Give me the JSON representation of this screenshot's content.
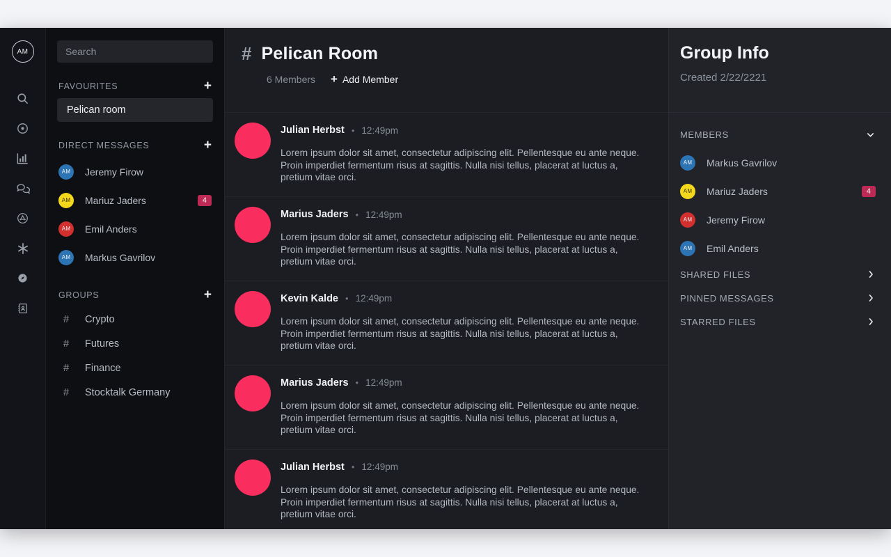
{
  "rail": {
    "avatar_initials": "AM",
    "icons": [
      {
        "name": "search-icon"
      },
      {
        "name": "record-circle-icon"
      },
      {
        "name": "bar-chart-icon"
      },
      {
        "name": "chat-bubbles-icon"
      },
      {
        "name": "app-store-circle-icon"
      },
      {
        "name": "asterisk-icon"
      },
      {
        "name": "compass-icon"
      },
      {
        "name": "address-book-icon"
      }
    ]
  },
  "sidebar": {
    "search": {
      "value": "",
      "placeholder": "Search"
    },
    "favourites": {
      "title": "FAVOURITES",
      "add_label": "+",
      "items": [
        {
          "label": "Pelican room"
        }
      ]
    },
    "direct_messages": {
      "title": "DIRECT MESSAGES",
      "add_label": "+",
      "items": [
        {
          "name": "Jeremy Firow",
          "initials": "AM",
          "color": "#2d74b5",
          "badge": ""
        },
        {
          "name": "Mariuz Jaders",
          "initials": "AM",
          "color": "#f4d81b",
          "badge": "4",
          "initials_color": "#3a3208"
        },
        {
          "name": "Emil Anders",
          "initials": "AM",
          "color": "#d2302f",
          "badge": ""
        },
        {
          "name": "Markus Gavrilov",
          "initials": "AM",
          "color": "#2d74b5",
          "badge": ""
        }
      ]
    },
    "groups": {
      "title": "GROUPS",
      "add_label": "+",
      "items": [
        {
          "label": "Crypto",
          "hash": "#"
        },
        {
          "label": "Futures",
          "hash": "#"
        },
        {
          "label": "Finance",
          "hash": "#"
        },
        {
          "label": "Stocktalk Germany",
          "hash": "#"
        }
      ]
    }
  },
  "chat": {
    "hash": "#",
    "title": "Pelican Room",
    "members_count": "6 Members",
    "add_member_plus": "+",
    "add_member_label": "Add Member",
    "messages": [
      {
        "author": "Julian Herbst",
        "dot": "•",
        "time": "12:49pm",
        "avatar_color": "#f92e5e",
        "text": "Lorem ipsum dolor sit amet, consectetur adipiscing elit. Pellentesque eu ante neque. Proin imperdiet fermentum risus at sagittis. Nulla nisi tellus, placerat at luctus a, pretium vitae orci."
      },
      {
        "author": "Marius Jaders",
        "dot": "•",
        "time": "12:49pm",
        "avatar_color": "#f92e5e",
        "text": "Lorem ipsum dolor sit amet, consectetur adipiscing elit. Pellentesque eu ante neque. Proin imperdiet fermentum risus at sagittis. Nulla nisi tellus, placerat at luctus a, pretium vitae orci."
      },
      {
        "author": "Kevin Kalde",
        "dot": "•",
        "time": "12:49pm",
        "avatar_color": "#f92e5e",
        "text": "Lorem ipsum dolor sit amet, consectetur adipiscing elit. Pellentesque eu ante neque. Proin imperdiet fermentum risus at sagittis. Nulla nisi tellus, placerat at luctus a, pretium vitae orci."
      },
      {
        "author": "Marius Jaders",
        "dot": "•",
        "time": "12:49pm",
        "avatar_color": "#f92e5e",
        "text": "Lorem ipsum dolor sit amet, consectetur adipiscing elit. Pellentesque eu ante neque. Proin imperdiet fermentum risus at sagittis. Nulla nisi tellus, placerat at luctus a, pretium vitae orci."
      },
      {
        "author": "Julian Herbst",
        "dot": "•",
        "time": "12:49pm",
        "avatar_color": "#f92e5e",
        "text": "Lorem ipsum dolor sit amet, consectetur adipiscing elit. Pellentesque eu ante neque. Proin imperdiet fermentum risus at sagittis. Nulla nisi tellus, placerat at luctus a, pretium vitae orci."
      }
    ]
  },
  "group_info": {
    "title": "Group Info",
    "created": "Created 2/22/2221",
    "members_label": "MEMBERS",
    "members": [
      {
        "name": "Markus Gavrilov",
        "initials": "AM",
        "color": "#2d74b5",
        "badge": ""
      },
      {
        "name": "Mariuz Jaders",
        "initials": "AM",
        "color": "#f4d81b",
        "badge": "4",
        "initials_color": "#3a3208"
      },
      {
        "name": "Jeremy Firow",
        "initials": "AM",
        "color": "#d2302f",
        "badge": ""
      },
      {
        "name": "Emil Anders",
        "initials": "AM",
        "color": "#2d74b5",
        "badge": ""
      }
    ],
    "links": [
      {
        "label": "SHARED FILES"
      },
      {
        "label": "PINNED MESSAGES"
      },
      {
        "label": "STARRED FILES"
      }
    ]
  },
  "colors": {
    "accent_pink": "#f92e5e",
    "badge": "#bd2a55",
    "page_bg": "#f3f4f7",
    "app_bg": "#15161b"
  }
}
